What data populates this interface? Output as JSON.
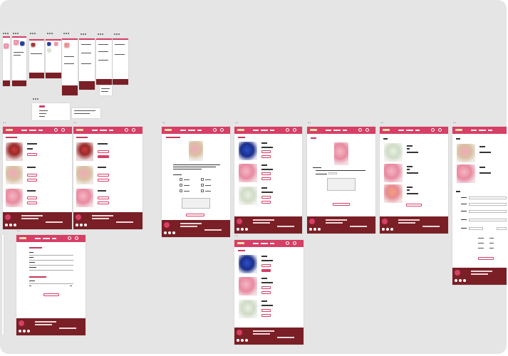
{
  "canvas": {
    "background": "#e5e5e5"
  },
  "colors": {
    "header": "#d63f66",
    "footer": "#7a1f26",
    "accent": "#d63f66",
    "logo": "#f7e1a8"
  },
  "frames": [
    {
      "id": "wishlist-page",
      "label": "•••"
    },
    {
      "id": "wishlist-page-variant",
      "label": "•••"
    },
    {
      "id": "order-form-page",
      "label": "•••"
    },
    {
      "id": "catalog-page",
      "label": "•••"
    },
    {
      "id": "product-detail-page",
      "label": "•••"
    },
    {
      "id": "cart-page",
      "label": "•••"
    },
    {
      "id": "checkout-page",
      "label": "•••"
    },
    {
      "id": "login-page",
      "label": "•••"
    },
    {
      "id": "catalog-page-variant",
      "label": "•••"
    }
  ],
  "icons": [
    "user-icon",
    "cart-icon",
    "facebook-icon",
    "instagram-icon",
    "twitter-icon"
  ]
}
